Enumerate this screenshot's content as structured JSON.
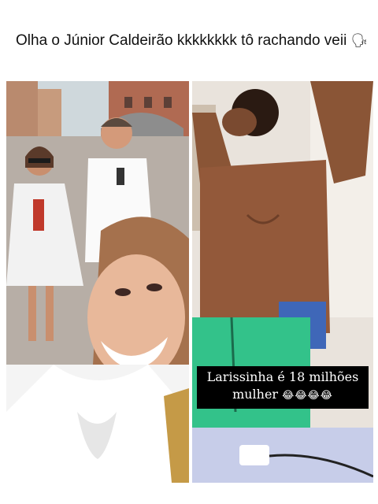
{
  "post": {
    "caption": "Olha o Júnior Caldeirão kkkkkkkk tô rachando veii",
    "caption_emoji": "🗣"
  },
  "right_video": {
    "overlay_line1": "Larissinha é 18 milhões",
    "overlay_line2": "mulher",
    "overlay_emojis": "😂😂😂😂"
  }
}
